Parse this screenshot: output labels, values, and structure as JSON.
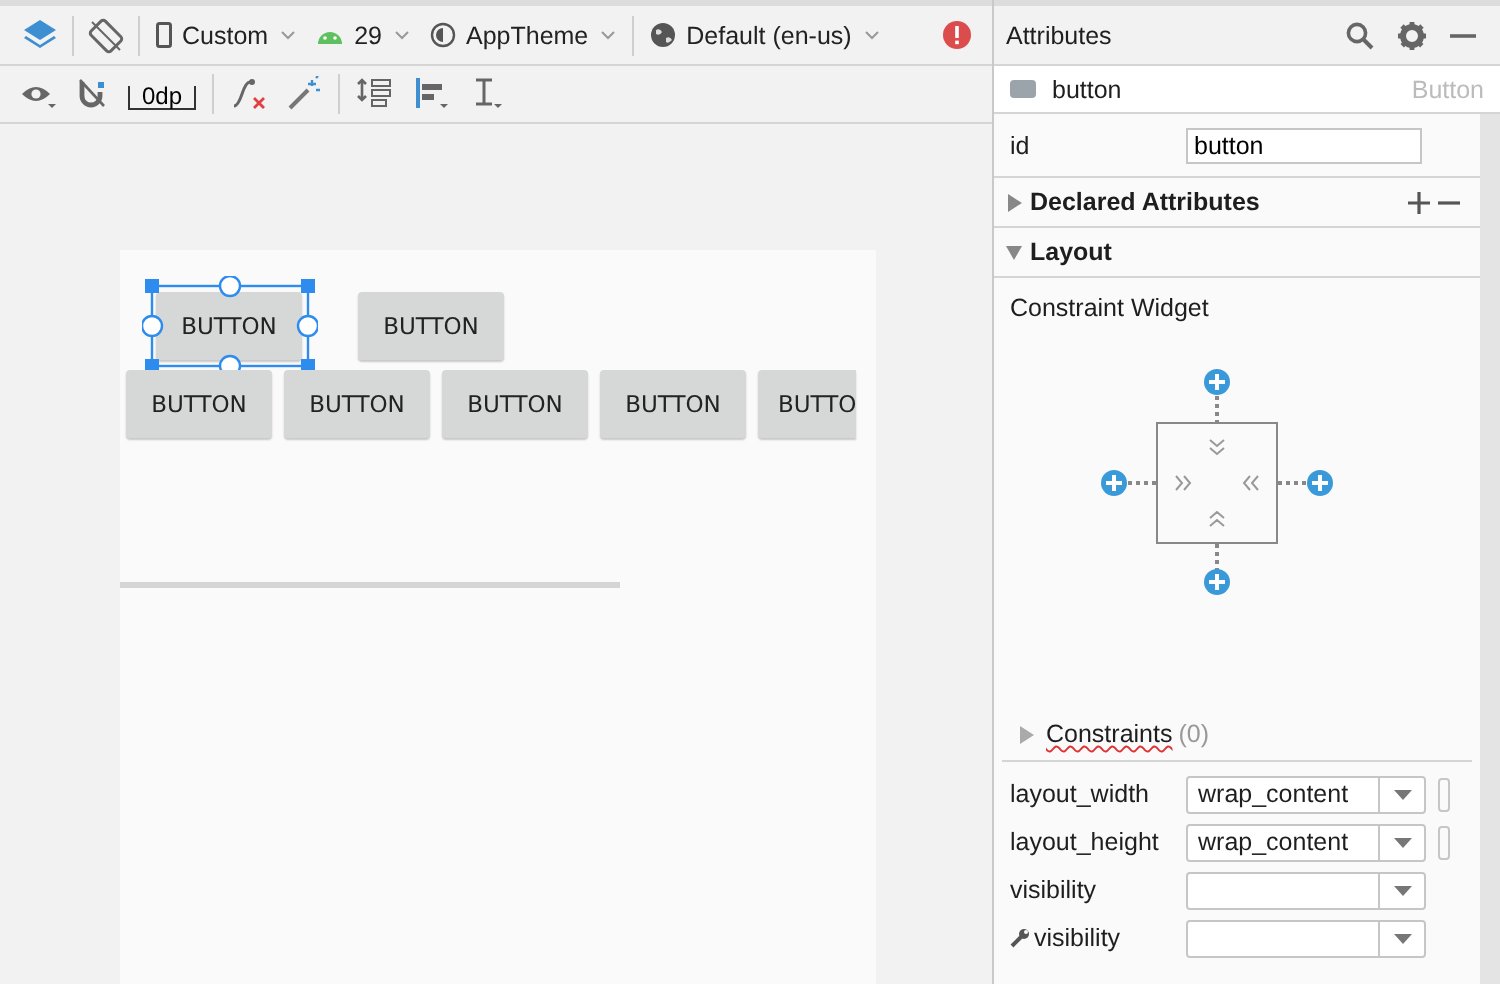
{
  "toolbar": {
    "device": "Custom",
    "api_level": "29",
    "theme": "AppTheme",
    "locale": "Default (en-us)"
  },
  "toolbar_2": {
    "margin": "0dp"
  },
  "canvas": {
    "rows": [
      [
        {
          "label": "BUTTON",
          "selected": true
        },
        {
          "label": "BUTTON",
          "selected": false
        }
      ],
      [
        {
          "label": "BUTTON",
          "selected": false
        },
        {
          "label": "BUTTON",
          "selected": false
        },
        {
          "label": "BUTTON",
          "selected": false
        },
        {
          "label": "BUTTON",
          "selected": false
        },
        {
          "label": "BUTTO",
          "selected": false
        }
      ]
    ]
  },
  "attributes": {
    "title": "Attributes",
    "component": {
      "name": "button",
      "type": "Button"
    },
    "id": {
      "label": "id",
      "value": "button"
    },
    "sections": [
      {
        "label": "Declared Attributes",
        "expanded": false
      },
      {
        "label": "Layout",
        "expanded": true
      }
    ],
    "widget_label": "Constraint Widget",
    "constraints": {
      "label": "Constraints",
      "count": "(0)",
      "expanded": false
    },
    "properties": [
      {
        "label": "layout_width",
        "value": "wrap_content",
        "tool": false,
        "extra": true
      },
      {
        "label": "layout_height",
        "value": "wrap_content",
        "tool": false,
        "extra": true
      },
      {
        "label": "visibility",
        "tool": false,
        "extra": false
      },
      {
        "label": "visibility",
        "tool": true,
        "extra": false
      }
    ]
  }
}
